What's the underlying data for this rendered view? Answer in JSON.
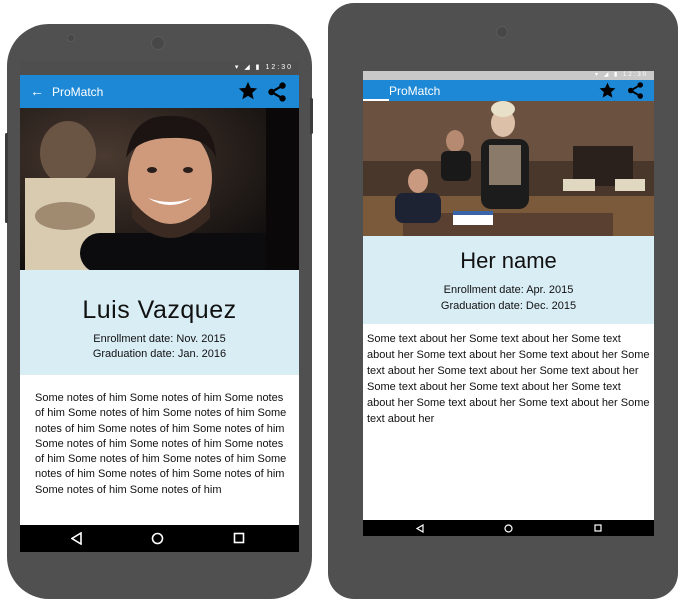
{
  "left_phone": {
    "app_title": "ProMatch",
    "status_time": "12:30",
    "name": "Luis Vazquez",
    "enrollment": "Enrollment date: Nov. 2015",
    "graduation": "Graduation date: Jan. 2016",
    "notes": "Some notes of him Some notes of him Some notes of him Some notes of him Some notes of him Some notes of him Some notes of him Some notes of him Some notes of him Some notes of him Some notes of him Some notes of him Some notes of him Some notes of him Some notes of him Some notes of him Some notes of him Some notes of him"
  },
  "right_phone": {
    "app_title": "ProMatch",
    "status_time": "12:30",
    "name": "Her name",
    "enrollment": "Enrollment date: Apr. 2015",
    "graduation": "Graduation date: Dec. 2015",
    "notes": "Some text about her Some text about her Some text about her Some text about her Some text about her Some text about her Some text about her Some text about her Some text about her Some text about her Some text about her Some text about her Some text about her Some text about her"
  },
  "icons": {
    "back": "arrow-left",
    "favorite": "star",
    "share": "share",
    "nav_back": "triangle-left",
    "nav_home": "circle",
    "nav_recents": "square"
  },
  "colors": {
    "app_bar": "#1c88d6",
    "header_band": "#d9edf5",
    "phone_body": "#505050",
    "nav_bar": "#000000"
  }
}
